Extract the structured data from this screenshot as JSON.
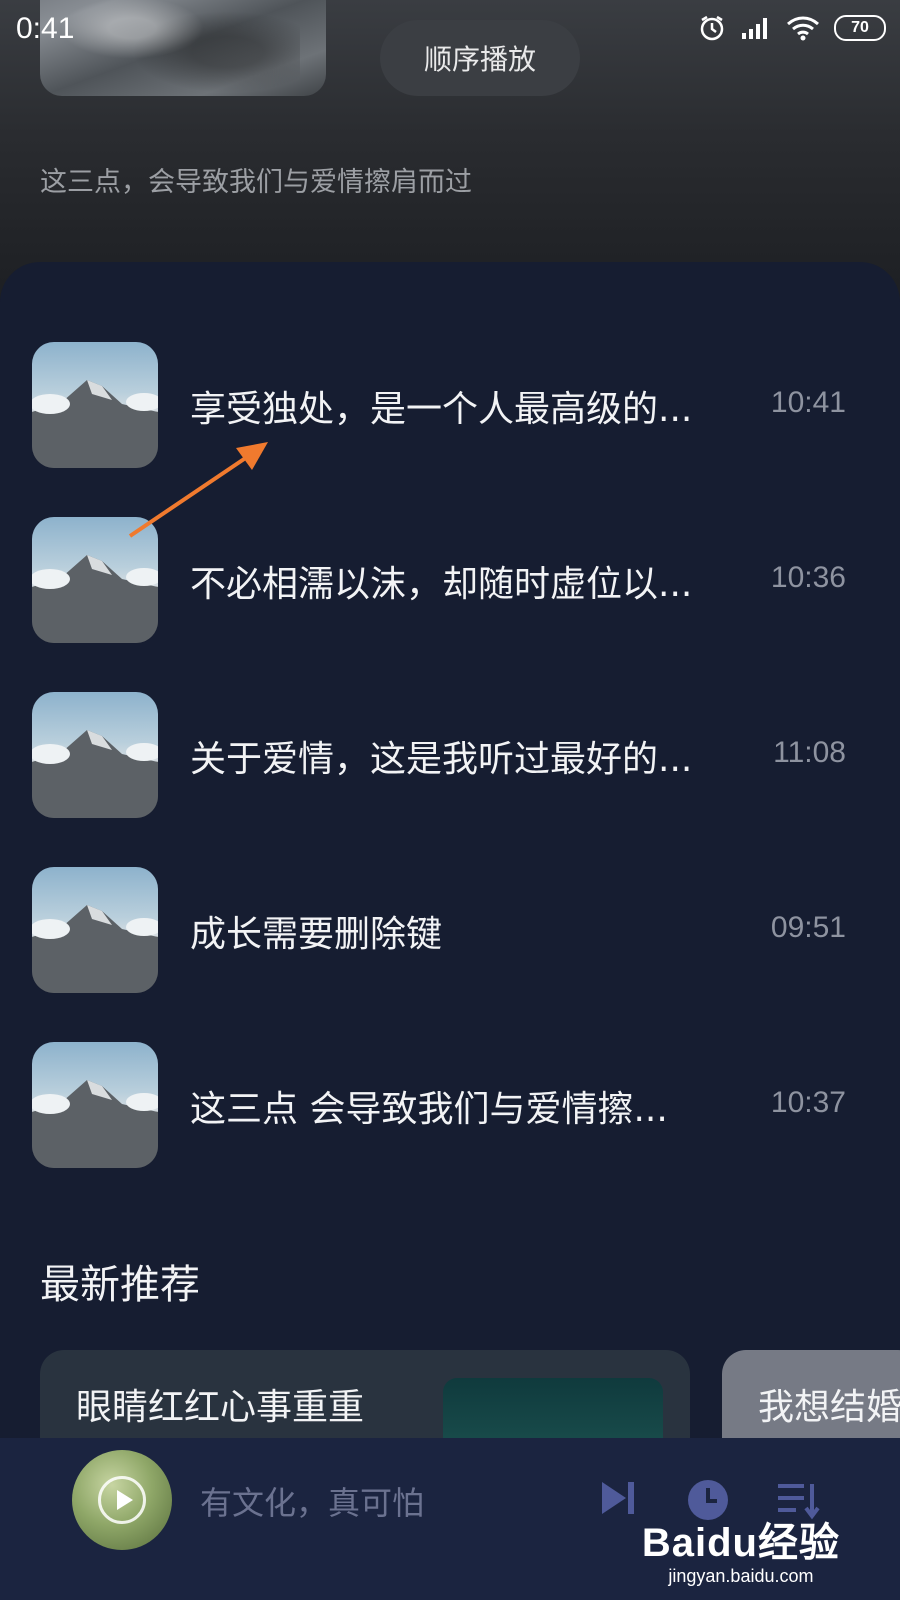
{
  "status_bar": {
    "time": "0:41",
    "battery": "70",
    "icons": [
      "alarm-icon",
      "signal-icon",
      "wifi-icon",
      "battery-icon"
    ]
  },
  "header": {
    "play_order_label": "顺序播放",
    "subtitle": "这三点，会导致我们与爱情擦肩而过"
  },
  "playlist": {
    "items": [
      {
        "title": "享受独处，是一个人最高级的...",
        "duration": "10:41"
      },
      {
        "title": "不必相濡以沫，却随时虚位以...",
        "duration": "10:36"
      },
      {
        "title": "关于爱情，这是我听过最好的...",
        "duration": "11:08"
      },
      {
        "title": "成长需要删除键",
        "duration": "09:51"
      },
      {
        "title": "这三点 会导致我们与爱情擦...",
        "duration": "10:37"
      }
    ]
  },
  "recommendations": {
    "section_title": "最新推荐",
    "cards": [
      {
        "title": "眼睛红红心事重重"
      },
      {
        "title": "我想结婚"
      }
    ]
  },
  "player": {
    "now_playing": "有文化，真可怕",
    "controls": [
      "next-icon",
      "timer-icon",
      "playlist-icon"
    ]
  },
  "watermark": {
    "logo": "Baidu经验",
    "url": "jingyan.baidu.com"
  },
  "colors": {
    "panel_bg": "#161d31",
    "player_bg": "#1b2440",
    "accent_arrow": "#f07a2e",
    "control_icon": "#4f5a9a"
  }
}
